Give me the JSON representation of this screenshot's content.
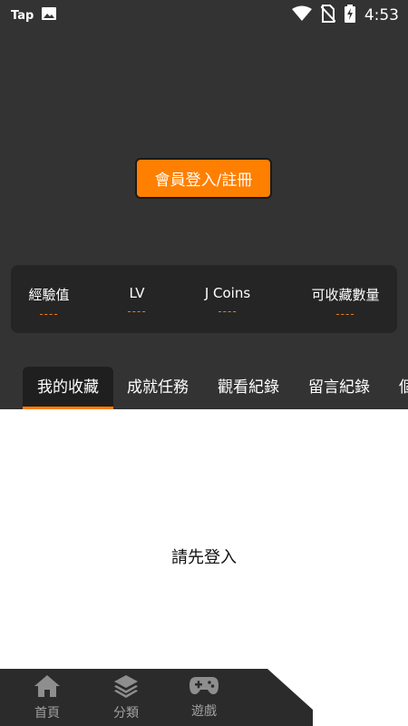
{
  "status_bar": {
    "app_tag": "Tap",
    "time": "4:53",
    "icons": [
      "image-icon",
      "wifi-icon",
      "no-sim-icon",
      "battery-charging-icon"
    ]
  },
  "profile": {
    "login_button": "會員登入/註冊"
  },
  "stats": [
    {
      "label": "經驗值",
      "value": "----"
    },
    {
      "label": "LV",
      "value": "----"
    },
    {
      "label": "J Coins",
      "value": "----"
    },
    {
      "label": "可收藏數量",
      "value": "----"
    }
  ],
  "tabs": [
    {
      "label": "我的收藏",
      "active": true
    },
    {
      "label": "成就任務"
    },
    {
      "label": "觀看紀錄"
    },
    {
      "label": "留言紀錄"
    },
    {
      "label": "個"
    }
  ],
  "content": {
    "empty_message": "請先登入"
  },
  "bottom_nav": [
    {
      "label": "首頁",
      "icon": "home-icon"
    },
    {
      "label": "分類",
      "icon": "layers-icon"
    },
    {
      "label": "遊戲",
      "icon": "gamepad-icon"
    }
  ],
  "colors": {
    "accent": "#ff7f00",
    "header_bg": "#333333",
    "card_bg": "#252525"
  }
}
